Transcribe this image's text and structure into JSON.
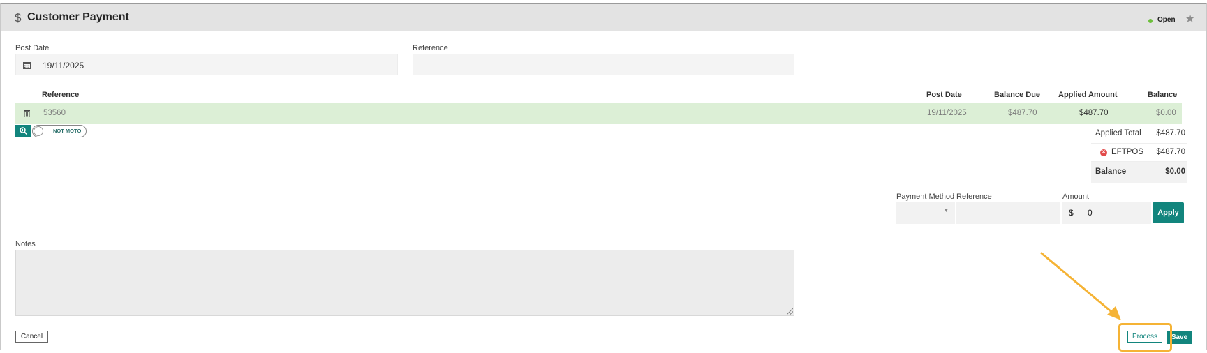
{
  "header": {
    "title": "Customer Payment",
    "icon": "dollar-icon",
    "status": "Open",
    "status_color": "#6cbf3b"
  },
  "form": {
    "post_date_label": "Post Date",
    "post_date_value": "19/11/2025",
    "reference_label": "Reference",
    "reference_value": ""
  },
  "table": {
    "columns": [
      "Reference",
      "Post Date",
      "Balance Due",
      "Applied Amount",
      "Balance"
    ],
    "rows": [
      {
        "reference": "53560",
        "post_date": "19/11/2025",
        "balance_due": "$487.70",
        "applied_amount": "$487.70",
        "balance": "$0.00"
      }
    ]
  },
  "moto_toggle": {
    "label": "NOT MOTO",
    "on": false
  },
  "summary": {
    "applied_total_label": "Applied Total",
    "applied_total_value": "$487.70",
    "payments": [
      {
        "method": "EFTPOS",
        "amount": "$487.70"
      }
    ],
    "balance_label": "Balance",
    "balance_value": "$0.00"
  },
  "payment_entry": {
    "method_label": "Payment Method",
    "method_value": "",
    "reference_label": "Reference",
    "reference_value": "",
    "amount_label": "Amount",
    "currency_symbol": "$",
    "amount_value": "0",
    "apply_label": "Apply"
  },
  "notes": {
    "label": "Notes",
    "value": ""
  },
  "footer": {
    "cancel_label": "Cancel",
    "process_label": "Process",
    "save_label": "Save"
  },
  "colors": {
    "accent": "#12857d",
    "row_highlight": "#dcefd6",
    "annotation": "#f5b335"
  }
}
